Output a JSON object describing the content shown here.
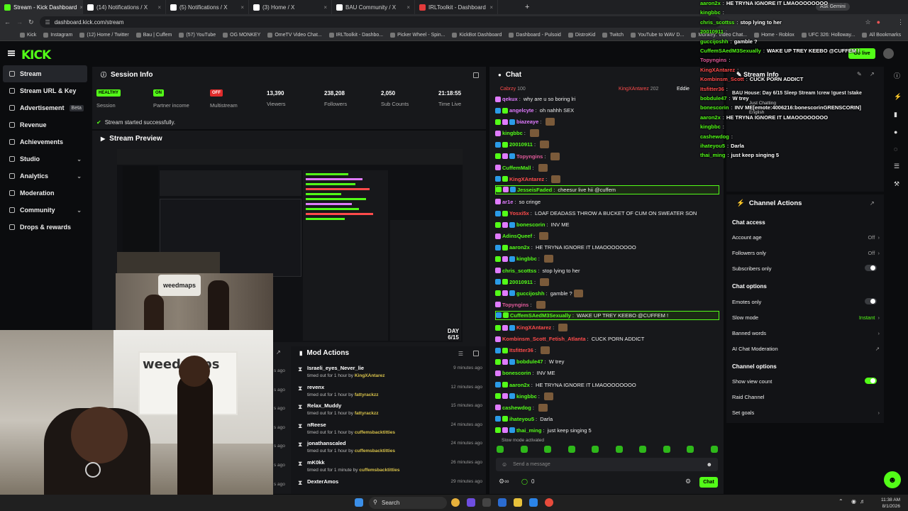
{
  "browser": {
    "tabs": [
      {
        "label": "Stream - Kick Dashboard",
        "active": true,
        "color": "#53fc18"
      },
      {
        "label": "(14) Notifications / X",
        "active": false,
        "color": "#ffffff"
      },
      {
        "label": "(5) Notifications / X",
        "active": false,
        "color": "#ffffff"
      },
      {
        "label": "(3) Home / X",
        "active": false,
        "color": "#ffffff"
      },
      {
        "label": "BAU Community / X",
        "active": false,
        "color": "#ffffff"
      },
      {
        "label": "IRLToolkit - Dashboard",
        "active": false,
        "color": "#e23b3b"
      }
    ],
    "url": "dashboard.kick.com/stream",
    "ask_gemini": "Ask Gemini",
    "bookmarks": [
      "Kick",
      "Instagram",
      "(12) Home / Twitter",
      "Bau | Cuffem",
      "(57) YouTube",
      "OG MONKEY",
      "OmeTV Video Chat...",
      "IRLToolkit - Dashbo...",
      "Picker Wheel - Spin...",
      "KickBot Dashboard",
      "Dashboard - Pulsoid",
      "DistroKid",
      "Twitch",
      "YouTube to WAV D...",
      "Monkey: Video Chat...",
      "Home - Roblox",
      "UFC 326: Holloway...",
      "All Bookmarks"
    ]
  },
  "kick": {
    "logo": "KICK",
    "go_live": "Go live"
  },
  "sidebar": {
    "items": [
      {
        "label": "Stream",
        "active": true,
        "chev": false,
        "beta": false
      },
      {
        "label": "Stream URL & Key",
        "active": false,
        "chev": false,
        "beta": false
      },
      {
        "label": "Advertisement",
        "active": false,
        "chev": false,
        "beta": true
      },
      {
        "label": "Revenue",
        "active": false,
        "chev": false,
        "beta": false
      },
      {
        "label": "Achievements",
        "active": false,
        "chev": false,
        "beta": false
      },
      {
        "label": "Studio",
        "active": false,
        "chev": true,
        "beta": false
      },
      {
        "label": "Analytics",
        "active": false,
        "chev": true,
        "beta": false
      },
      {
        "label": "Moderation",
        "active": false,
        "chev": false,
        "beta": false
      },
      {
        "label": "Community",
        "active": false,
        "chev": true,
        "beta": false
      },
      {
        "label": "Drops & rewards",
        "active": false,
        "chev": false,
        "beta": false
      }
    ],
    "beta_label": "Beta"
  },
  "session": {
    "title": "Session Info",
    "session_badge": "HEALTHY",
    "session_label": "Session",
    "partner_badge": "ON",
    "partner_label": "Partner income",
    "multistream_badge": "OFF",
    "multistream_label": "Multistream",
    "viewers": "13,390",
    "viewers_label": "Viewers",
    "followers": "238,208",
    "followers_label": "Followers",
    "subs": "2,050",
    "subs_label": "Sub Counts",
    "time": "21:18:55",
    "time_label": "Time Live",
    "status": "Stream started successfully."
  },
  "preview": {
    "title": "Stream Preview",
    "day_counter": "DAY 6/15"
  },
  "chat": {
    "title": "Chat",
    "pinned_user": "KingXAntarez",
    "pinned_count": "202",
    "pinned_user2": "Eddie",
    "first_user": "Cabrzy",
    "first_count": "100",
    "messages": [
      {
        "user": "qekux",
        "color": "#e07bff",
        "text": "why are u so boring lri",
        "hl": false
      },
      {
        "user": "angelcyte",
        "color": "#e07bff",
        "text": "oh nahhh SEX",
        "hl": false
      },
      {
        "user": "biazeaye",
        "color": "#e07bff",
        "text": "",
        "hl": false
      },
      {
        "user": "kingbbc",
        "color": "#53fc18",
        "text": "",
        "hl": false
      },
      {
        "user": "20010911",
        "color": "#53fc18",
        "text": "",
        "hl": false
      },
      {
        "user": "Topyngins",
        "color": "#e05a9a",
        "text": "",
        "hl": false
      },
      {
        "user": "CuffemMall",
        "color": "#53fc18",
        "text": "",
        "hl": false
      },
      {
        "user": "KingXAntarez",
        "color": "#ff4b4b",
        "text": "",
        "hl": false
      },
      {
        "user": "JesseisFaded",
        "color": "#53fc18",
        "text": "cheesur live hii @cuffem",
        "hl": true
      },
      {
        "user": "ar1e",
        "color": "#e07bff",
        "text": "so cringe",
        "hl": false
      },
      {
        "user": "Yosxi5x",
        "color": "#ff4b4b",
        "text": "LOAF DEADASS THROW A BUCKET OF CUM ON SWEATER SON",
        "hl": false
      },
      {
        "user": "bonescorin",
        "color": "#53fc18",
        "text": "INV ME",
        "hl": false
      },
      {
        "user": "AdinsQueef",
        "color": "#53fc18",
        "text": "",
        "hl": false
      },
      {
        "user": "aaron2x",
        "color": "#53fc18",
        "text": "HE TRYNA IGNORE IT LMAOOOOOOOO",
        "hl": false
      },
      {
        "user": "kingbbc",
        "color": "#53fc18",
        "text": "",
        "hl": false
      },
      {
        "user": "chris_scottss",
        "color": "#53fc18",
        "text": "stop lying to her",
        "hl": false
      },
      {
        "user": "20010911",
        "color": "#53fc18",
        "text": "",
        "hl": false
      },
      {
        "user": "guccijoshh",
        "color": "#53fc18",
        "text": "gamble ?",
        "hl": false
      },
      {
        "user": "Topyngins",
        "color": "#e05a9a",
        "text": "",
        "hl": false
      },
      {
        "user": "CuffemSAedM3Sexually",
        "color": "#53fc18",
        "text": "WAKE UP TREY KEEBO @CUFFEM !",
        "hl": true
      },
      {
        "user": "KingXAntarez",
        "color": "#ff4b4b",
        "text": "",
        "hl": false
      },
      {
        "user": "Kombinsm_Scott_Fetish_Atlanta",
        "color": "#ff4b4b",
        "text": "CUCK PORN ADDICT",
        "hl": false
      },
      {
        "user": "Itsfitter36",
        "color": "#ff4b4b",
        "text": "",
        "hl": false
      },
      {
        "user": "bobdule47",
        "color": "#53fc18",
        "text": "W trey",
        "hl": false
      },
      {
        "user": "bonescorin",
        "color": "#53fc18",
        "text": "INV ME",
        "hl": false
      },
      {
        "user": "aaron2x",
        "color": "#53fc18",
        "text": "HE TRYNA IGNORE IT LMAOOOOOOOO",
        "hl": false
      },
      {
        "user": "kingbbc",
        "color": "#53fc18",
        "text": "",
        "hl": false
      },
      {
        "user": "cashewdog",
        "color": "#53fc18",
        "text": "",
        "hl": false
      },
      {
        "user": "ihateyou5",
        "color": "#53fc18",
        "text": "Darla",
        "hl": false
      },
      {
        "user": "thai_ming",
        "color": "#53fc18",
        "text": "just keep singing 5",
        "hl": false
      }
    ],
    "slow_mode": "Slow mode activated",
    "placeholder": "Send a message",
    "points": "0",
    "send": "Chat"
  },
  "mod": {
    "title": "Mod Actions",
    "rows": [
      {
        "name": "Israeli_eyes_Never_lie",
        "desc": "timed out for 1 hour by",
        "by": "KingXAntarez",
        "time": "9 minutes ago"
      },
      {
        "name": "revenx",
        "desc": "timed out for 1 hour by",
        "by": "fattyrackzz",
        "time": "12 minutes ago"
      },
      {
        "name": "Relax_Muddy",
        "desc": "timed out for 1 hour by",
        "by": "fattyrackzz",
        "time": "15 minutes ago"
      },
      {
        "name": "nReese",
        "desc": "timed out for 1 hour by",
        "by": "cuffemsbacktitties",
        "time": "24 minutes ago"
      },
      {
        "name": "jonathanscaled",
        "desc": "timed out for 1 hour by",
        "by": "cuffemsbacktitties",
        "time": "24 minutes ago"
      },
      {
        "name": "mK0kk",
        "desc": "timed out for 1 minute by",
        "by": "cuffemsbacktitties",
        "time": "26 minutes ago"
      },
      {
        "name": "DexterAmos",
        "desc": "",
        "by": "",
        "time": "29 minutes ago"
      }
    ],
    "left_times": [
      "s ago",
      "s ago",
      "s ago",
      "s ago",
      "s ago",
      "s ago",
      "s ago"
    ]
  },
  "channel": {
    "title": "Channel Actions",
    "chat_access": "Chat access",
    "account_age": "Account age",
    "account_age_val": "Off",
    "followers_only": "Followers only",
    "followers_only_val": "Off",
    "subs_only": "Subscribers only",
    "chat_options": "Chat options",
    "emotes_only": "Emotes only",
    "slow_mode": "Slow mode",
    "slow_mode_val": "Instant",
    "banned_words": "Banned words",
    "ai_mod": "AI Chat Moderation",
    "channel_options": "Channel options",
    "show_view_count": "Show view count",
    "raid": "Raid Channel",
    "goals": "Set goals",
    "stream_info": "Stream Info",
    "stream_info_text": "BAU House: Day 6/15 Sleep Stream !crew !guest !stake",
    "stream_info_cat": "Just Chatting",
    "stream_info_lang": "English"
  },
  "overlay": {
    "lines": [
      {
        "user": "aaron2x",
        "color": "#53fc18",
        "text": "HE TRYNA IGNORE IT LMAOOOOOOOO"
      },
      {
        "user": "kingbbc",
        "color": "#53fc18",
        "text": ""
      },
      {
        "user": "chris_scottss",
        "color": "#53fc18",
        "text": "stop lying to her"
      },
      {
        "user": "20010911",
        "color": "#53fc18",
        "text": ""
      },
      {
        "user": "guccijoshh",
        "color": "#53fc18",
        "text": "gamble ?"
      },
      {
        "user": "CuffemSAedM3Sexually",
        "color": "#53fc18",
        "text": "WAKE UP TREY KEEBO @CUFFEM !"
      },
      {
        "user": "Topyngins",
        "color": "#e05a9a",
        "text": ""
      },
      {
        "user": "KingXAntarez",
        "color": "#ff4b4b",
        "text": ""
      },
      {
        "user": "Kombinsm_Scott",
        "color": "#ff4b4b",
        "text": "CUCK PORN ADDICT"
      },
      {
        "user": "Itsfitter36",
        "color": "#ff4b4b",
        "text": ""
      },
      {
        "user": "bobdule47",
        "color": "#53fc18",
        "text": "W trey"
      },
      {
        "user": "bonescorin",
        "color": "#53fc18",
        "text": "INV ME[emote:4006216:bonescorinGRENSCORIN]"
      },
      {
        "user": "aaron2x",
        "color": "#53fc18",
        "text": "HE TRYNA IGNORE IT LMAOOOOOOOO"
      },
      {
        "user": "kingbbc",
        "color": "#53fc18",
        "text": ""
      },
      {
        "user": "cashewdog",
        "color": "#53fc18",
        "text": ""
      },
      {
        "user": "ihateyou5",
        "color": "#53fc18",
        "text": "Darla"
      },
      {
        "user": "thai_ming",
        "color": "#53fc18",
        "text": "just keep singing 5"
      }
    ]
  },
  "taskbar": {
    "search": "Search",
    "time": "11:38 AM",
    "date": "8/1/2026"
  },
  "webcam": {
    "banner_text": "weedmaps"
  }
}
